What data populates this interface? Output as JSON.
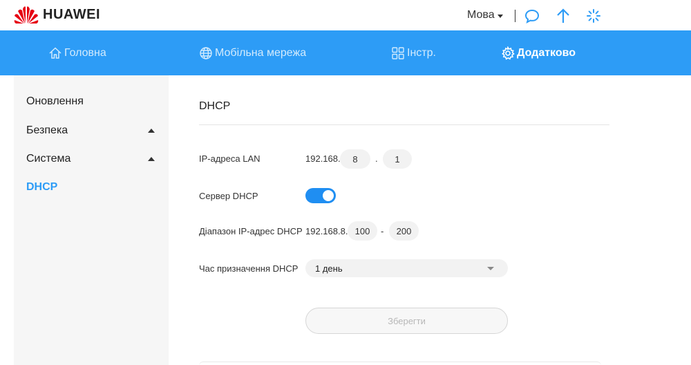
{
  "brand": {
    "name": "HUAWEI",
    "logo_icon": "huawei-petals-icon",
    "logo_color": "#e60012"
  },
  "header": {
    "language_label": "Мова",
    "icons": [
      "message-icon",
      "upload-arrow-icon",
      "loading-spinner-icon"
    ],
    "accent": "#2d9cf6"
  },
  "nav": {
    "items": [
      {
        "label": "Головна",
        "icon": "home-icon",
        "active": false
      },
      {
        "label": "Мобільна мережа",
        "icon": "globe-icon",
        "active": false
      },
      {
        "label": "Інстр.",
        "icon": "tools-grid-icon",
        "active": false
      },
      {
        "label": "Додатково",
        "icon": "gear-icon",
        "active": true
      }
    ],
    "background": "#2d9cf6"
  },
  "sidebar": {
    "items": [
      {
        "label": "Оновлення",
        "expandable": false,
        "active": false
      },
      {
        "label": "Безпека",
        "expandable": true,
        "active": false
      },
      {
        "label": "Система",
        "expandable": true,
        "active": false
      },
      {
        "label": "DHCP",
        "expandable": false,
        "active": true
      }
    ]
  },
  "main": {
    "title": "DHCP",
    "lan_ip": {
      "label": "IP-адреса LAN",
      "prefix": "192.168.",
      "octet3": "8",
      "separator": ".",
      "octet4": "1"
    },
    "dhcp_server": {
      "label": "Сервер DHCP",
      "enabled": true
    },
    "ip_range": {
      "label": "Діапазон IP-адрес DHCP",
      "prefix": "192.168.8.",
      "start": "100",
      "separator": "-",
      "end": "200"
    },
    "lease_time": {
      "label": "Час призначення DHCP",
      "value": "1 день"
    },
    "save_label": "Зберегти"
  }
}
